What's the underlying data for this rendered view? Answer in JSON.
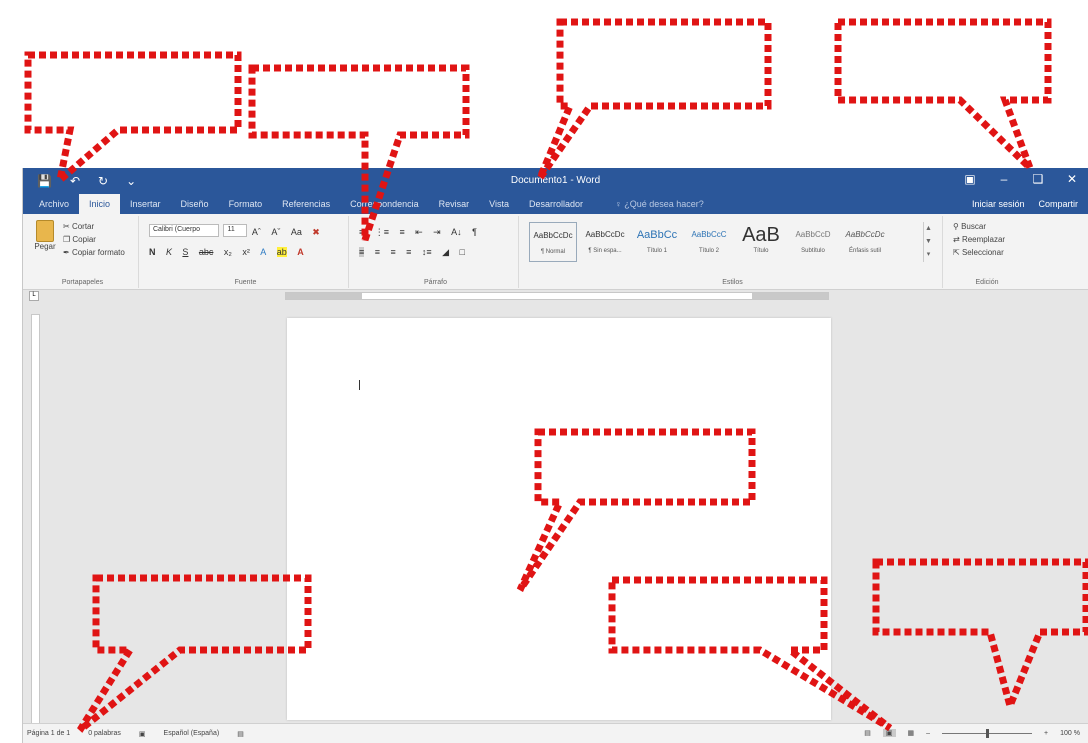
{
  "window": {
    "title": "Documento1 - Word",
    "quick_access": {
      "save_icon": "save-icon",
      "undo_icon": "undo-icon",
      "redo_icon": "redo-icon"
    }
  },
  "tabs": [
    {
      "label": "Archivo"
    },
    {
      "label": "Inicio"
    },
    {
      "label": "Insertar"
    },
    {
      "label": "Diseño"
    },
    {
      "label": "Formato"
    },
    {
      "label": "Referencias"
    },
    {
      "label": "Correspondencia"
    },
    {
      "label": "Revisar"
    },
    {
      "label": "Vista"
    },
    {
      "label": "Desarrollador"
    }
  ],
  "tell_me": "♀ ¿Qué desea hacer?",
  "share": {
    "signin": "Iniciar sesión",
    "share": "Compartir"
  },
  "ribbon": {
    "clipboard": {
      "paste": "Pegar",
      "cut": "Cortar",
      "copy": "Copiar",
      "format_painter": "Copiar formato",
      "label": "Portapapeles"
    },
    "font": {
      "font_name": "Calibri (Cuerpo",
      "font_size": "11",
      "label": "Fuente"
    },
    "paragraph": {
      "label": "Párrafo"
    },
    "styles": {
      "label": "Estilos",
      "items": [
        {
          "preview": "AaBbCcDc",
          "name": "¶ Normal"
        },
        {
          "preview": "AaBbCcDc",
          "name": "¶ Sin espa..."
        },
        {
          "preview": "AaBbCc",
          "name": "Título 1"
        },
        {
          "preview": "AaBbCcC",
          "name": "Título 2"
        },
        {
          "preview": "AaB",
          "name": "Título"
        },
        {
          "preview": "AaBbCcD",
          "name": "Subtítulo"
        },
        {
          "preview": "AaBbCcDc",
          "name": "Énfasis sutil"
        }
      ]
    },
    "editing": {
      "find": "Buscar",
      "replace": "Reemplazar",
      "select": "Seleccionar",
      "label": "Edición"
    }
  },
  "status": {
    "page": "Página 1 de 1",
    "words": "0 palabras",
    "language": "Español (España)"
  },
  "zoom_percent": "100 %"
}
